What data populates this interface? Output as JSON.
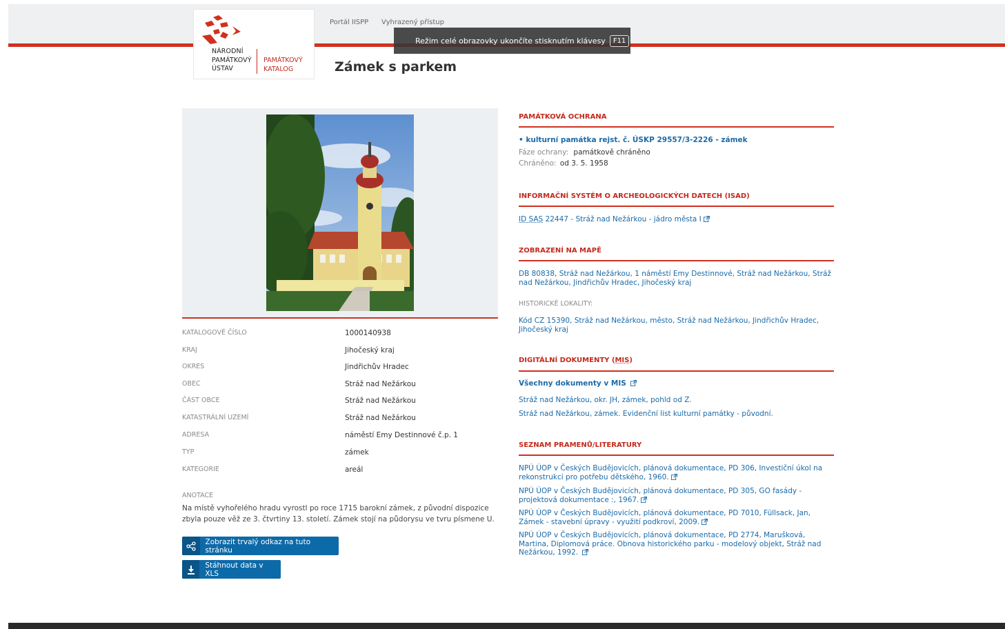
{
  "header": {
    "logo": {
      "line1": "NÁRODNÍ",
      "line2": "PAMÁTKOVÝ",
      "line3": "ÚSTAV",
      "pk1": "PAMÁTKOVÝ",
      "pk2": "KATALOG"
    },
    "nav": [
      {
        "label": "Portál IISPP"
      },
      {
        "label": "Vyhrazený přístup"
      }
    ],
    "title": "Zámek s parkem",
    "fullscreen_notice": "Režim celé obrazovky ukončíte stisknutím klávesy",
    "fullscreen_key": "F11"
  },
  "details": {
    "rows": [
      {
        "label": "KATALOGOVÉ ČÍSLO",
        "value": "1000140938"
      },
      {
        "label": "KRAJ",
        "value": "Jihočeský kraj"
      },
      {
        "label": "OKRES",
        "value": "Jindřichův Hradec"
      },
      {
        "label": "OBEC",
        "value": "Stráž nad Nežárkou"
      },
      {
        "label": "ČÁST OBCE",
        "value": "Stráž nad Nežárkou"
      },
      {
        "label": "KATASTRÁLNÍ UZEMÍ",
        "value": "Stráž nad Nežárkou"
      },
      {
        "label": "ADRESA",
        "value": "náměstí Emy Destinnové č.p. 1"
      },
      {
        "label": "TYP",
        "value": "zámek"
      },
      {
        "label": "KATEGORIE",
        "value": "areál"
      }
    ],
    "annotation_label": "ANOTACE",
    "annotation_text": "Na místě vyhořelého hradu vyrostl po roce 1715 barokní zámek, z původní dispozice zbyla pouze věž ze 3. čtvrtiny 13. století. Zámek stojí na půdorysu ve tvru písmene U.",
    "buttons": {
      "permalink": "Zobrazit trvalý odkaz na tuto stránku",
      "download": "Stáhnout data v XLS"
    }
  },
  "right": {
    "protection": {
      "title": "PAMÁTKOVÁ OCHRANA",
      "link": "• kulturní památka rejst. č. ÚSKP 29557/3-2226 - zámek",
      "phase_label": "Fáze ochrany:",
      "phase_value": "památkově chráněno",
      "protected_label": "Chráněno:",
      "protected_value": "od 3. 5. 1958"
    },
    "isad": {
      "title": "INFORMAČNÍ SYSTÉM O ARCHEOLOGICKÝCH DATECH (ISAD)",
      "link_prefix": "ID SAS",
      "link_rest": " 22447 - Stráž nad Nežárkou - jádro města I"
    },
    "map": {
      "title": "ZOBRAZENÍ NA MAPĚ",
      "link": "DB 80838, Stráž nad Nežárkou, 1 náměstí Emy Destinnové, Stráž nad Nežárkou, Stráž nad Nežárkou, Jindřichův Hradec, Jihočeský kraj",
      "historic_label": "HISTORICKÉ LOKALITY:",
      "historic_link": "Kód CZ 15390, Stráž nad Nežárkou, město, Stráž nad Nežárkou, Jindřichův Hradec, Jihočeský kraj"
    },
    "documents": {
      "title_prefix": "DIGITÁLNÍ DOKUMENTY (",
      "title_abbr": "MIS",
      "title_suffix": ")",
      "all_link": "Všechny dokumenty v MIS",
      "items": [
        "Stráž nad Nežárkou, okr. JH, zámek, pohld od Z.",
        "Stráž nad Nežárkou, zámek. Evidenční list kulturní památky - původní."
      ]
    },
    "sources": {
      "title": "SEZNAM PRAMENŮ/LITERATURY",
      "items": [
        "NPÚ ÚOP v Českých Budějovicích, plánová dokumentace, PD 306, Investiční úkol na rekonstrukci pro potřebu dětského, 1960.",
        "NPÚ ÚOP v Českých Budějovicích, plánová dokumentace, PD 305, GO fasády - projektová dokumentace :, 1967.",
        "NPÚ ÚOP v Českých Budějovicích, plánová dokumentace, PD 7010, Füllsack, Jan, Zámek - stavební úpravy - využití podkroví, 2009.",
        "NPÚ ÚOP v Českých Budějovicích, plánová dokumentace, PD 2774, Marušková, Martina, Diplomová práce. Obnova historického parku - modelový objekt, Stráž nad Nežárkou, 1992."
      ]
    }
  },
  "colors": {
    "accent": "#d1301f",
    "link": "#1a6aa8",
    "button": "#0d6aa8"
  }
}
